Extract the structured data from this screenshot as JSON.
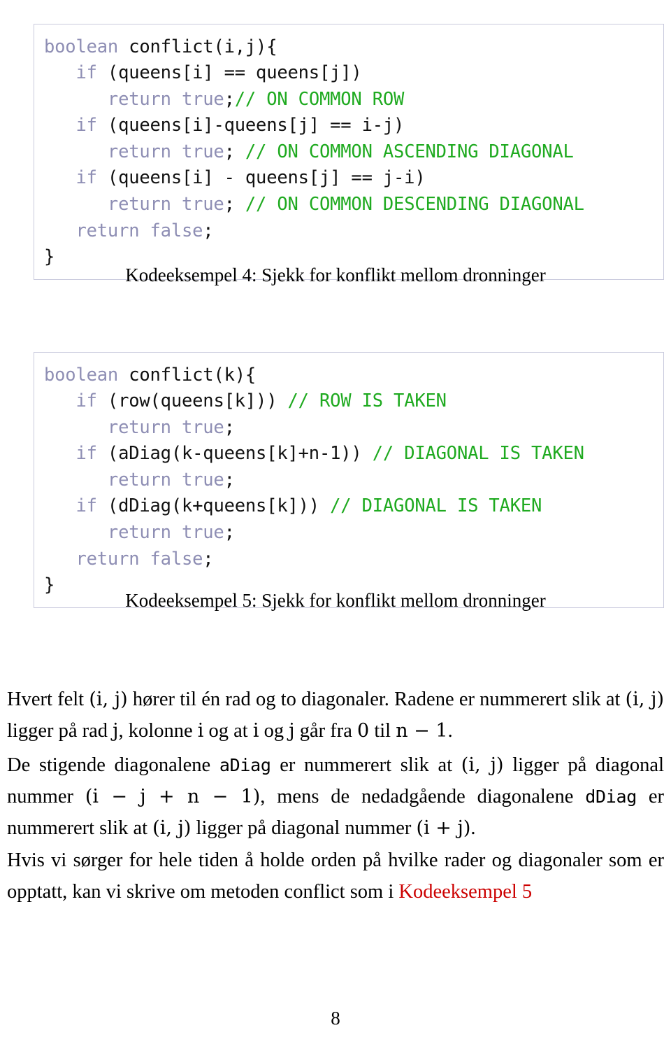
{
  "document": {
    "page_number": "8",
    "colors": {
      "keyword": "#8e8eb4",
      "comment": "#1faa20",
      "plain_code": "#111111",
      "link": "#cc0000",
      "code_border": "#c9cadd",
      "background": "#ffffff"
    }
  },
  "code_block_1": {
    "caption": "Kodeeksempel 4: Sjekk for konflikt mellom dronninger",
    "lines": [
      [
        {
          "t": "boolean",
          "c": "kw"
        },
        {
          "t": " conflict(i,j){",
          "c": "pl"
        }
      ],
      [
        {
          "t": "   if",
          "c": "kw"
        },
        {
          "t": " (queens[i] == queens[j])",
          "c": "pl"
        }
      ],
      [
        {
          "t": "      return true",
          "c": "kw"
        },
        {
          "t": ";",
          "c": "pl"
        },
        {
          "t": "// ON COMMON ROW",
          "c": "cm"
        }
      ],
      [
        {
          "t": "   if",
          "c": "kw"
        },
        {
          "t": " (queens[i]-queens[j] == i-j)",
          "c": "pl"
        }
      ],
      [
        {
          "t": "      return true",
          "c": "kw"
        },
        {
          "t": "; ",
          "c": "pl"
        },
        {
          "t": "// ON COMMON ASCENDING DIAGONAL",
          "c": "cm"
        }
      ],
      [
        {
          "t": "   if",
          "c": "kw"
        },
        {
          "t": " (queens[i] - queens[j] == j-i)",
          "c": "pl"
        }
      ],
      [
        {
          "t": "      return true",
          "c": "kw"
        },
        {
          "t": "; ",
          "c": "pl"
        },
        {
          "t": "// ON COMMON DESCENDING DIAGONAL",
          "c": "cm"
        }
      ],
      [
        {
          "t": "   return false",
          "c": "kw"
        },
        {
          "t": ";",
          "c": "pl"
        }
      ],
      [
        {
          "t": "}",
          "c": "pl"
        }
      ]
    ]
  },
  "code_block_2": {
    "caption": "Kodeeksempel 5: Sjekk for konflikt mellom dronninger",
    "lines": [
      [
        {
          "t": "boolean",
          "c": "kw"
        },
        {
          "t": " conflict(k){",
          "c": "pl"
        }
      ],
      [
        {
          "t": "   if",
          "c": "kw"
        },
        {
          "t": " (row(queens[k])) ",
          "c": "pl"
        },
        {
          "t": "// ROW IS TAKEN",
          "c": "cm"
        }
      ],
      [
        {
          "t": "      return true",
          "c": "kw"
        },
        {
          "t": ";",
          "c": "pl"
        }
      ],
      [
        {
          "t": "   if",
          "c": "kw"
        },
        {
          "t": " (aDiag(k-queens[k]+n-1)) ",
          "c": "pl"
        },
        {
          "t": "// DIAGONAL IS TAKEN",
          "c": "cm"
        }
      ],
      [
        {
          "t": "      return true",
          "c": "kw"
        },
        {
          "t": ";",
          "c": "pl"
        }
      ],
      [
        {
          "t": "   if",
          "c": "kw"
        },
        {
          "t": " (dDiag(k+queens[k])) ",
          "c": "pl"
        },
        {
          "t": "// DIAGONAL IS TAKEN",
          "c": "cm"
        }
      ],
      [
        {
          "t": "      return true",
          "c": "kw"
        },
        {
          "t": ";",
          "c": "pl"
        }
      ],
      [
        {
          "t": "   return false",
          "c": "kw"
        },
        {
          "t": ";",
          "c": "pl"
        }
      ],
      [
        {
          "t": "}",
          "c": "pl"
        }
      ]
    ]
  },
  "paragraphs": [
    {
      "id": "para-1",
      "runs": [
        {
          "t": "Hvert felt ",
          "s": "normal"
        },
        {
          "t": "(i, j)",
          "s": "math"
        },
        {
          "t": " hører til én rad og to diagonaler. Radene er nummerert slik at ",
          "s": "normal"
        },
        {
          "t": "(i, j)",
          "s": "math"
        },
        {
          "t": " ligger på rad ",
          "s": "normal"
        },
        {
          "t": "j",
          "s": "math"
        },
        {
          "t": ", kolonne ",
          "s": "normal"
        },
        {
          "t": "i",
          "s": "math"
        },
        {
          "t": " og at ",
          "s": "normal"
        },
        {
          "t": "i",
          "s": "math"
        },
        {
          "t": " og ",
          "s": "normal"
        },
        {
          "t": "j",
          "s": "math"
        },
        {
          "t": " går fra ",
          "s": "normal"
        },
        {
          "t": "0",
          "s": "math"
        },
        {
          "t": " til ",
          "s": "normal"
        },
        {
          "t": "n − 1",
          "s": "math"
        },
        {
          "t": ".",
          "s": "normal"
        }
      ]
    },
    {
      "id": "para-2",
      "runs": [
        {
          "t": "De stigende diagonalene ",
          "s": "normal"
        },
        {
          "t": "aDiag",
          "s": "mono"
        },
        {
          "t": " er nummerert slik at ",
          "s": "normal"
        },
        {
          "t": "(i, j)",
          "s": "math"
        },
        {
          "t": " ligger på diagonal nummer ",
          "s": "normal"
        },
        {
          "t": "(i − j + n − 1)",
          "s": "math"
        },
        {
          "t": ", mens de nedadgående diagonalene ",
          "s": "normal"
        },
        {
          "t": "dDiag",
          "s": "mono"
        },
        {
          "t": " er nummerert slik at ",
          "s": "normal"
        },
        {
          "t": "(i, j)",
          "s": "math"
        },
        {
          "t": " ligger på diagonal nummer ",
          "s": "normal"
        },
        {
          "t": "(i + j)",
          "s": "math"
        },
        {
          "t": ".",
          "s": "normal"
        }
      ]
    },
    {
      "id": "para-3",
      "runs": [
        {
          "t": "Hvis vi sørger for hele tiden å holde orden på hvilke rader og diagonaler som er opptatt, kan vi skrive om metoden conflict som i ",
          "s": "normal"
        },
        {
          "t": "Kodeeksempel 5",
          "s": "link"
        }
      ]
    }
  ]
}
